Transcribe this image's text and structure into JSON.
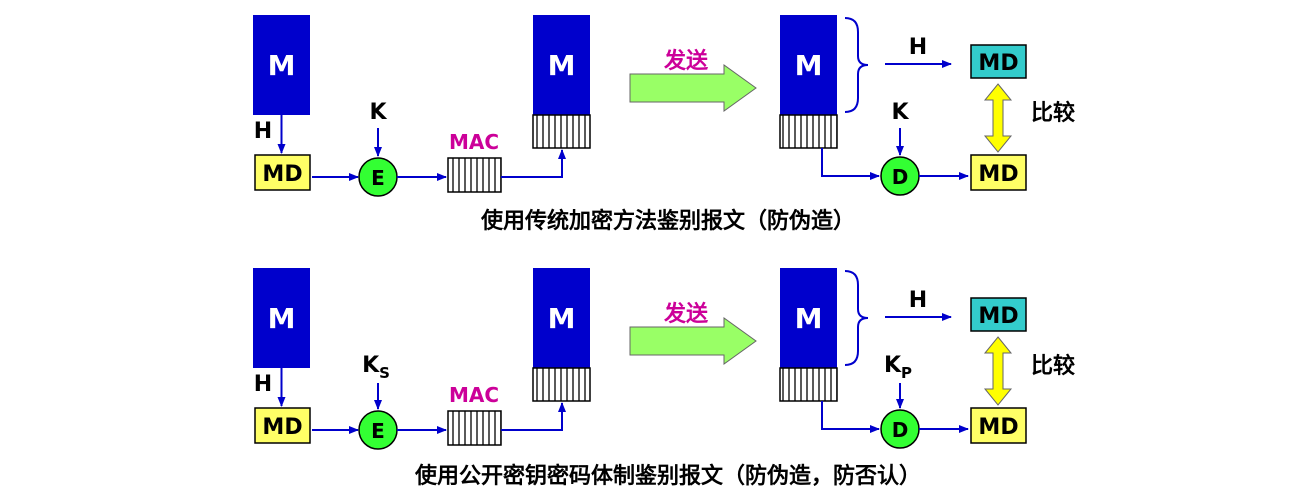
{
  "panels": [
    {
      "message": "M",
      "hash": "H",
      "digest": "MD",
      "encrypt_op": "E",
      "encrypt_key": "K",
      "encrypt_key_sub": "",
      "mac": "MAC",
      "message2": "M",
      "send": "发送",
      "message3": "M",
      "hash2": "H",
      "digest2": "MD",
      "decrypt_key": "K",
      "decrypt_key_sub": "",
      "decrypt_op": "D",
      "digest3": "MD",
      "compare": "比较",
      "caption": "使用传统加密方法鉴别报文（防伪造）"
    },
    {
      "message": "M",
      "hash": "H",
      "digest": "MD",
      "encrypt_op": "E",
      "encrypt_key": "K",
      "encrypt_key_sub": "S",
      "mac": "MAC",
      "message2": "M",
      "send": "发送",
      "message3": "M",
      "hash2": "H",
      "digest2": "MD",
      "decrypt_key": "K",
      "decrypt_key_sub": "P",
      "decrypt_op": "D",
      "digest3": "MD",
      "compare": "比较",
      "caption": "使用公开密钥密码体制鉴别报文（防伪造，防否认）"
    }
  ],
  "colors": {
    "message_block": "#0000cc",
    "digest_yellow": "#ffff66",
    "digest_cyan": "#33cccc",
    "op_green": "#33ff33",
    "arrow_blue": "#0000cc",
    "mac_text": "#cc0099",
    "send_arrow": "#99ff66",
    "compare_arrow": "#ffff00"
  }
}
